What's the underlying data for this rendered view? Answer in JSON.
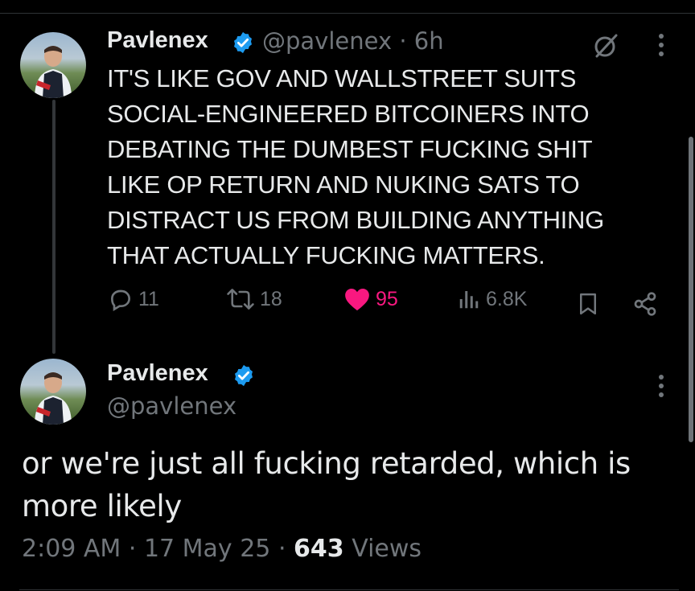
{
  "reply_tweet": {
    "author_name": "Pavlenex",
    "author_handle": "@pavlenex",
    "separator": "·",
    "time_ago": "6h",
    "text": "IT'S LIKE GOV AND WALLSTREET SUITS\nSOCIAL-ENGINEERED BITCOINERS INTO\nDEBATING THE DUMBEST FUCKING SHIT\nLIKE OP RETURN AND NUKING SATS TO\nDISTRACT US FROM BUILDING ANYTHING\nTHAT ACTUALLY FUCKING MATTERS.",
    "replies": "11",
    "reposts": "18",
    "likes": "95",
    "views": "6.8K"
  },
  "main_tweet": {
    "author_name": "Pavlenex",
    "author_handle": "@pavlenex",
    "text": "or we're just all fucking retarded, which is more likely",
    "time": "2:09 AM",
    "date": "17 May 25",
    "separator": "·",
    "view_count": "643",
    "views_label": "Views"
  },
  "icons": {
    "verified": "verified-badge-icon",
    "grok": "grok-icon",
    "more": "more-icon",
    "reply": "reply-icon",
    "repost": "repost-icon",
    "like": "heart-icon",
    "views": "views-icon",
    "bookmark": "bookmark-icon",
    "share": "share-icon"
  },
  "colors": {
    "background": "#000000",
    "text": "#e7e9ea",
    "muted": "#71767b",
    "verified": "#1d9bf0",
    "like": "#f91880"
  }
}
